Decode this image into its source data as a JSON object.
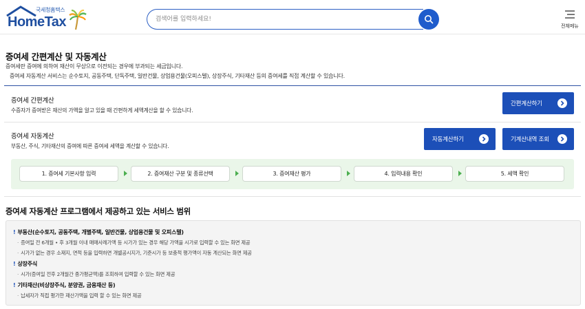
{
  "header": {
    "logo_sub": "국세청홈택스",
    "logo_main": "HomeTax",
    "search_placeholder": "검색어를 입력하세요!",
    "menu_label": "전체메뉴",
    "icons": {
      "search": "search-icon",
      "menu": "hamburger-menu-icon"
    },
    "colors": {
      "brand": "#1f4fa0",
      "search_border": "#2b5fc4"
    }
  },
  "intro": {
    "title": "증여세 간편계산 및 자동계산",
    "desc1": "증여세란 증여에 의하여 재산이 무상으로 이전되는 경우에 부과되는 세금입니다.",
    "desc2": "증여세 자동계산 서비스는 순수토지, 공동주택, 단독주택, 일반건물, 상업용건물(오피스텔), 상장주식, 기타재산 등의 증여세를 직접 계산할 수 있습니다."
  },
  "simple": {
    "title": "증여세 간편계산",
    "desc": "수증자가 증여받은 재산의 가액을 알고 있을 때 간편하게 세액계산을 할 수 있습니다.",
    "button": "간편계산하기"
  },
  "auto": {
    "title": "증여세 자동계산",
    "desc": "부동산, 주식, 기타재산의 증여에 따른 증여세 세액을 계산할 수 있습니다.",
    "button_calc": "자동계산하기",
    "button_history": "기계산내역 조회"
  },
  "steps": [
    {
      "label": "1. 증여세 기본사항 입력"
    },
    {
      "label": "2. 증여재산 구분 및 종류선택"
    },
    {
      "label": "3. 증여재산 평가"
    },
    {
      "label": "4. 입력내용 확인"
    },
    {
      "label": "5. 세액 확인"
    }
  ],
  "range": {
    "title": "증여세 자동계산 프로그램에서 제공하고 있는 서비스 범위",
    "categories": [
      {
        "title": "부동산(순수토지, 공동주택, 개별주택, 일반건물, 상업용건물 및 오피스텔)",
        "items": [
          "증여일 전 6개월  •  후 3개월 이내 매매사례가액 등 시가가 있는 경우 해당 가액을 시가로 입력할 수 있는 화면 제공",
          "시가가 없는 경우 소재지, 면적 등을 입력하면 개별공시지가, 기준시가 등 보충적 평가액이 자동 계산되는 화면 제공"
        ]
      },
      {
        "title": "상장주식",
        "items": [
          "시가(증여일 전후 2개월간 종가평균액)를 조회하여 입력할 수 있는 화면 제공"
        ]
      },
      {
        "title": "기타재산(비상장주식, 분양권, 금융재산 등)",
        "items": [
          "납세자가 직접 평가한 재산가액을 입력 할 수 있는 화면 제공"
        ]
      }
    ]
  }
}
